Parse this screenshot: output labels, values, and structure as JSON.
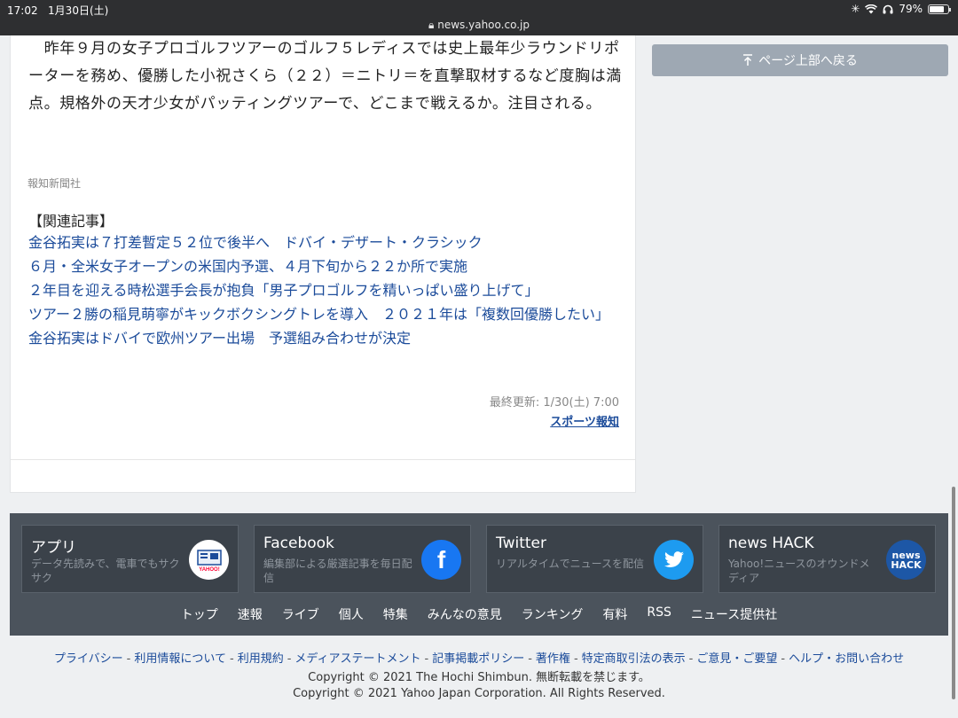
{
  "status_bar": {
    "time": "17:02",
    "date": "1月30日(土)",
    "url": "news.yahoo.co.jp",
    "battery": "79%",
    "battery_level": 0.79
  },
  "article": {
    "body": "　昨年９月の女子プロゴルフツアーのゴルフ５レディスでは史上最年少ラウンドリポーターを務め、優勝した小祝さくら（２２）＝ニトリ＝を直撃取材するなど度胸は満点。規格外の天才少女がパッティングツアーで、どこまで戦えるか。注目される。",
    "source": "報知新聞社",
    "related_heading": "【関連記事】",
    "related": [
      "金谷拓実は７打差暫定５２位で後半へ　ドバイ・デザート・クラシック",
      "６月・全米女子オープンの米国内予選、４月下旬から２２か所で実施",
      "２年目を迎える時松選手会長が抱負「男子プロゴルフを精いっぱい盛り上げて」",
      "ツアー２勝の稲見萌寧がキックボクシングトレを導入　２０２１年は「複数回優勝したい」",
      "金谷拓実はドバイで欧州ツアー出場　予選組み合わせが決定"
    ],
    "updated": "最終更新: 1/30(土) 7:00",
    "publisher": "スポーツ報知"
  },
  "back_to_top": "ページ上部へ戻る",
  "footer": {
    "apps": [
      {
        "title": "アプリ",
        "desc": "データ先読みで、電車でもサクサク",
        "icon": "yahoo-app-icon"
      },
      {
        "title": "Facebook",
        "desc": "編集部による厳選記事を毎日配信",
        "icon": "facebook-icon",
        "glyph": "f"
      },
      {
        "title": "Twitter",
        "desc": "リアルタイムでニュースを配信",
        "icon": "twitter-icon"
      },
      {
        "title": "news HACK",
        "desc": "Yahoo!ニュースのオウンドメディア",
        "icon": "news-hack-icon",
        "glyph_top": "news",
        "glyph_bottom": "HACK"
      }
    ],
    "nav": [
      "トップ",
      "速報",
      "ライブ",
      "個人",
      "特集",
      "みんなの意見",
      "ランキング",
      "有料",
      "RSS",
      "ニュース提供社"
    ]
  },
  "legal": {
    "links": [
      "プライバシー",
      "利用情報について",
      "利用規約",
      "メディアステートメント",
      "記事掲載ポリシー",
      "著作権",
      "特定商取引法の表示",
      "ご意見・ご要望",
      "ヘルプ・お問い合わせ"
    ],
    "copyright_hochi": "Copyright © 2021 The Hochi Shimbun. 無断転載を禁じます。",
    "copyright_yahoo": "Copyright © 2021 Yahoo Japan Corporation. All Rights Reserved."
  }
}
